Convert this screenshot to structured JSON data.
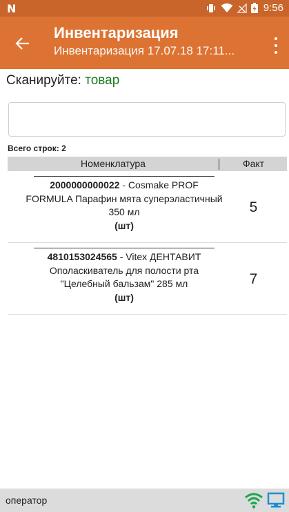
{
  "status_bar": {
    "time": "9:56",
    "icons": [
      "n-logo",
      "vibrate-icon",
      "wifi-signal-icon",
      "no-signal-icon",
      "battery-charging-icon"
    ]
  },
  "app_bar": {
    "title": "Инвентаризация",
    "subtitle": "Инвентаризация 17.07.18 17:11...",
    "back_icon": "arrow-left-icon",
    "menu_icon": "more-vert-icon"
  },
  "scan": {
    "prompt": "Сканируйте:",
    "target": "товар",
    "input_value": ""
  },
  "table": {
    "rows_count_label": "Всего строк: 2",
    "headers": [
      "Номенклатура",
      "Факт"
    ],
    "rows": [
      {
        "barcode": "2000000000022",
        "name": " - Cosmake PROF FORMULA Парафин мята суперэластичный 350 мл",
        "unit": "(шт)",
        "fact": "5"
      },
      {
        "barcode": "4810153024565",
        "name": " - Vitex ДЕНТАВИТ Ополаскиватель для полости рта \"Целебный бальзам\" 285 мл",
        "unit": "(шт)",
        "fact": "7"
      }
    ]
  },
  "bottom_bar": {
    "user": "оператор",
    "icons": [
      "wifi-icon",
      "monitor-icon"
    ]
  },
  "colors": {
    "status_bar": "#c9652a",
    "app_bar": "#dd7332",
    "scan_target": "#1c7a1c",
    "wifi": "#19a84a",
    "monitor": "#1a8fd6"
  }
}
